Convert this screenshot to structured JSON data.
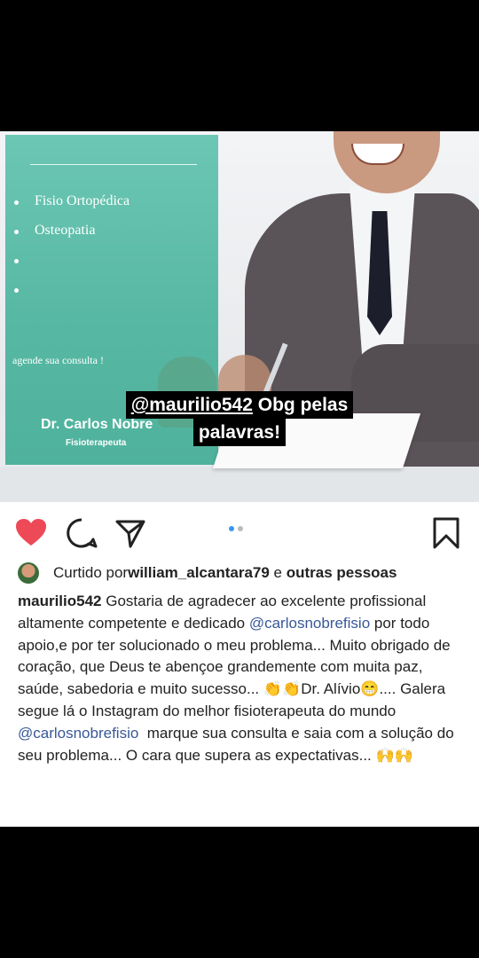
{
  "story": {
    "flyer_items": [
      "Fisio Ortopédica",
      "Osteopatia",
      "",
      ""
    ],
    "flyer_cta": "agende sua consulta !",
    "flyer_doctor": "Dr. Carlos Nobre",
    "flyer_role": "Fisioterapeuta",
    "caption_mention": "@maurilio542",
    "caption_line1_rest": " Obg pelas",
    "caption_line2": "palavras!"
  },
  "post": {
    "icons": {
      "like": "heart-icon",
      "comment": "comment-icon",
      "share": "share-icon",
      "save": "bookmark-icon"
    },
    "colors": {
      "heart": "#ed4956",
      "link": "#385898",
      "dot_active": "#3897f0"
    },
    "carousel": {
      "count": 2,
      "active": 1
    },
    "likes": {
      "prefix": "Curtido por ",
      "user": "william_alcantara79",
      "middle": " e ",
      "others": "outras pessoas"
    },
    "caption": {
      "username": "maurilio542",
      "text1": " Gostaria de agradecer ao excelente profissional altamente competente e dedicado ",
      "mention1": "@carlosnobrefisio",
      "text2": " por todo apoio,e por ter solucionado o meu problema... Muito obrigado de coração, que Deus te abençoe grandemente com muita paz, saúde, sabedoria e muito sucesso... 👏👏Dr. Alívio😁.... Galera segue lá o Instagram do melhor fisioterapeuta do mundo ",
      "mention2": "@carlosnobrefisio",
      "text3": "  marque sua consulta e saia com a solução do seu problema... O cara que supera as expectativas... 🙌🙌"
    }
  }
}
